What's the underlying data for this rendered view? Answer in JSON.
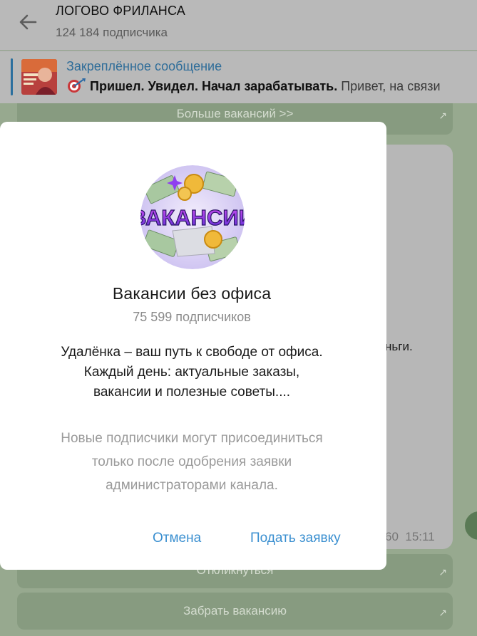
{
  "header": {
    "title": "ЛОГОВО ФРИЛАНСА",
    "subscribers": "124 184 подписчика"
  },
  "pinned": {
    "label": "Закреплённое сообщение",
    "bold_text": "Пришел. Увидел. Начал зарабатывать.",
    "rest_text": "Привет, на связи"
  },
  "chat": {
    "more_vacancies_button": "Больше вакансий >>",
    "respond_button": "Откликнуться",
    "take_vacancy_button": "Забрать вакансию",
    "message_fragment": "ньги.",
    "message_views_fragment": "60",
    "message_time": "15:11",
    "external_arrow": "↗"
  },
  "dialog": {
    "avatar_text": "ВАКАНСИИ",
    "title": "Вакансии без офиса",
    "subscribers": "75 599 подписчиков",
    "description_lines": [
      "Удалёнка – ваш путь к свободе от офиса.",
      "Каждый день: актуальные заказы,",
      "вакансии и полезные советы...."
    ],
    "note_lines": [
      "Новые подписчики могут присоединиться",
      "только после одобрения заявки",
      "администраторами канала."
    ],
    "cancel_label": "Отмена",
    "apply_label": "Подать заявку"
  },
  "colors": {
    "accent": "#3a8fd0",
    "pinned_title": "#2f6d99",
    "overlay_header": "#b9b9b9",
    "chat_background": "#97a98f"
  }
}
